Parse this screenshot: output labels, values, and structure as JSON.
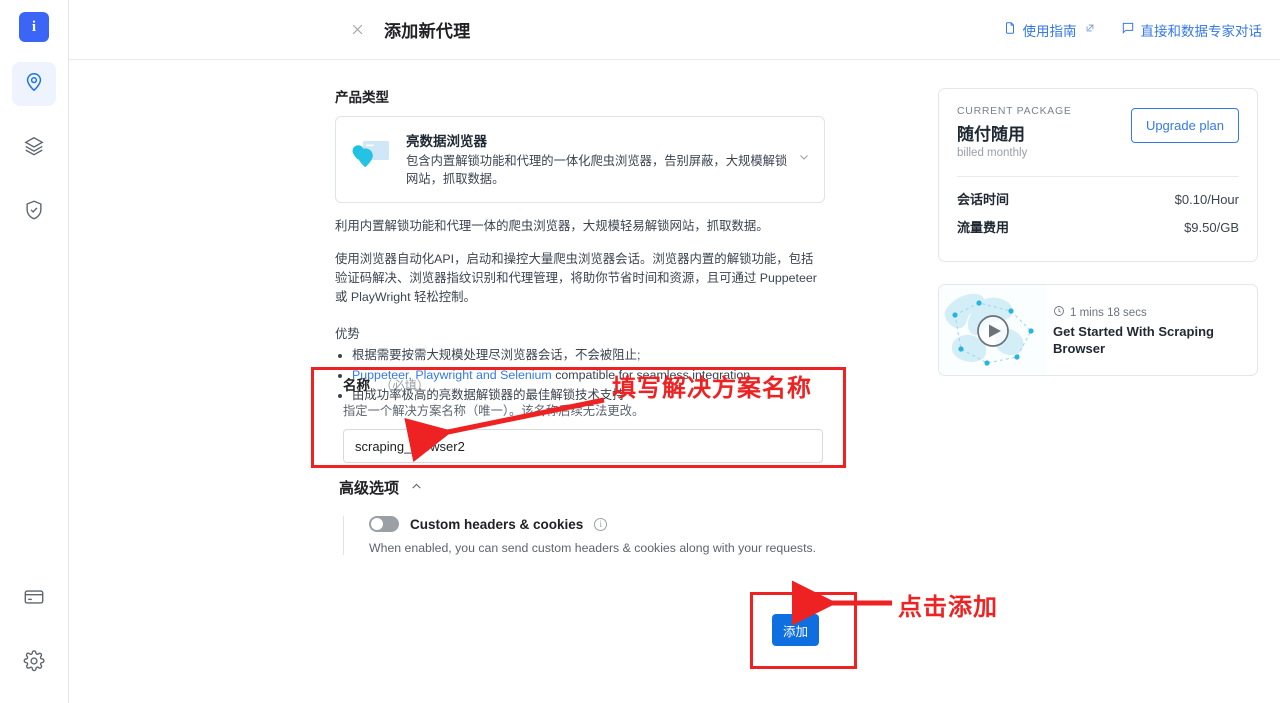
{
  "rail": {
    "logo_text": "i",
    "items": [
      {
        "name": "proxy-infrastructure",
        "icon": "location-pin-icon",
        "active": true
      },
      {
        "name": "datasets",
        "icon": "layers-icon",
        "active": false
      },
      {
        "name": "security",
        "icon": "shield-check-icon",
        "active": false
      }
    ],
    "bottom_items": [
      {
        "name": "billing",
        "icon": "credit-card-icon"
      },
      {
        "name": "settings",
        "icon": "gear-icon"
      }
    ]
  },
  "topbar": {
    "close_icon": "close-icon",
    "title": "添加新代理",
    "links": [
      {
        "label": "使用指南",
        "icon": "document-icon",
        "external": true
      },
      {
        "label": "直接和数据专家对话",
        "icon": "chat-bubble-icon",
        "external": false
      }
    ]
  },
  "main": {
    "product_type_label": "产品类型",
    "product_card": {
      "title": "亮数据浏览器",
      "description": "包含内置解锁功能和代理的一体化爬虫浏览器，告别屏蔽，大规模解锁网站，抓取数据。",
      "chevron_icon": "chevron-down-icon"
    },
    "paragraphs": [
      "利用内置解锁功能和代理一体的爬虫浏览器，大规模轻易解锁网站，抓取数据。",
      "使用浏览器自动化API，启动和操控大量爬虫浏览器会话。浏览器内置的解锁功能，包括验证码解决、浏览器指纹识别和代理管理，将助你节省时间和资源，且可通过 Puppeteer 或 PlayWright 轻松控制。"
    ],
    "advantages_label": "优势",
    "advantages": [
      {
        "text": "根据需要按需大规模处理尽浏览器会话，不会被阻止;",
        "link": null
      },
      {
        "text": " compatible for seamless integration",
        "link": "Puppeteer, Playwright and Selenium"
      },
      {
        "text": "由成功率极高的亮数据解锁器的最佳解锁技术支持",
        "link": null
      }
    ],
    "name_field": {
      "label": "名称",
      "required_hint": "（必填）",
      "help": "指定一个解决方案名称（唯一）。该名称后续无法更改。",
      "value": "scraping_browser2",
      "placeholder": ""
    },
    "advanced": {
      "title": "高级选项",
      "caret_icon": "chevron-up-icon",
      "toggle_label": "Custom headers & cookies",
      "toggle_state": "off",
      "info_icon": "info-icon",
      "toggle_description": "When enabled, you can send custom headers & cookies along with your requests."
    },
    "submit_label": "添加"
  },
  "right": {
    "package": {
      "eyebrow": "CURRENT PACKAGE",
      "name": "随付随用",
      "billed": "billed monthly",
      "upgrade_label": "Upgrade plan",
      "rows": [
        {
          "key": "会话时间",
          "value": "$0.10/Hour"
        },
        {
          "key": "流量费用",
          "value": "$9.50/GB"
        }
      ]
    },
    "video": {
      "duration": "1 mins 18 secs",
      "clock_icon": "clock-icon",
      "play_icon": "play-icon",
      "title": "Get Started With Scraping Browser"
    }
  },
  "annotations": [
    {
      "name": "fill-solution-name",
      "text": "填写解决方案名称"
    },
    {
      "name": "click-add",
      "text": "点击添加"
    }
  ],
  "colors": {
    "accent_blue": "#3579e6",
    "primary_button": "#0f6fe0",
    "annotation_red": "#ee2222",
    "logo_blue": "#3b65f6"
  }
}
